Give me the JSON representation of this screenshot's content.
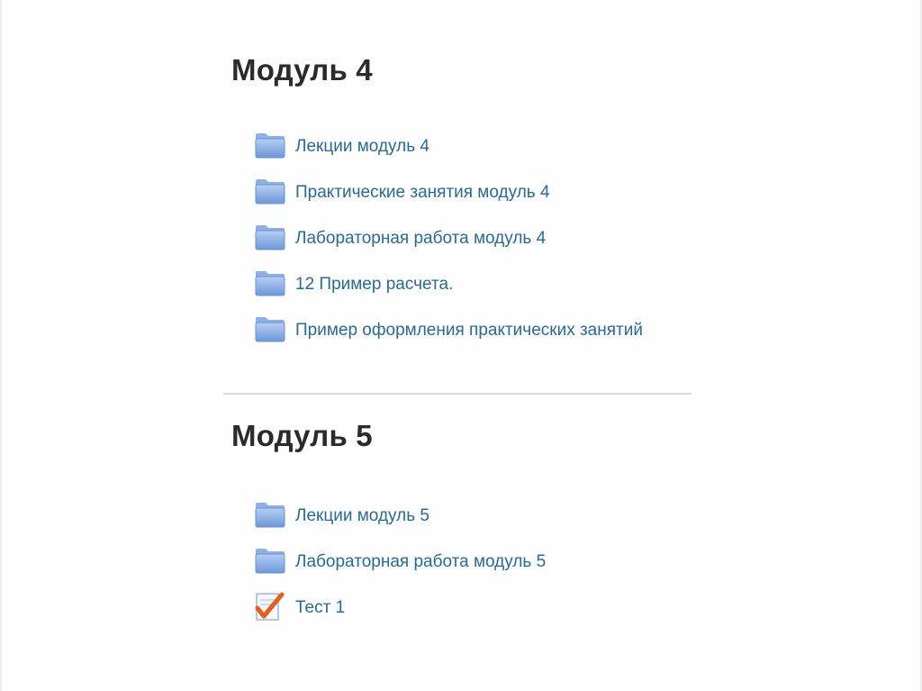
{
  "sections": [
    {
      "title": "Модуль 4",
      "activities": [
        {
          "label": "Лекции модуль 4",
          "icon": "folder-icon"
        },
        {
          "label": "Практические занятия модуль 4",
          "icon": "folder-icon"
        },
        {
          "label": "Лабораторная работа модуль 4",
          "icon": "folder-icon"
        },
        {
          "label": "12 Пример расчета.",
          "icon": "folder-icon"
        },
        {
          "label": "Пример оформления практических занятий",
          "icon": "folder-icon"
        }
      ]
    },
    {
      "title": "Модуль 5",
      "activities": [
        {
          "label": "Лекции модуль 5",
          "icon": "folder-icon"
        },
        {
          "label": "Лабораторная работа модуль 5",
          "icon": "folder-icon"
        },
        {
          "label": "Тест 1",
          "icon": "quiz-checkmark-icon"
        }
      ]
    }
  ],
  "colors": {
    "link": "#2a6a94",
    "heading": "#2b2b2b",
    "folder": "#7fa7e0",
    "quiz_check": "#e0601c"
  }
}
